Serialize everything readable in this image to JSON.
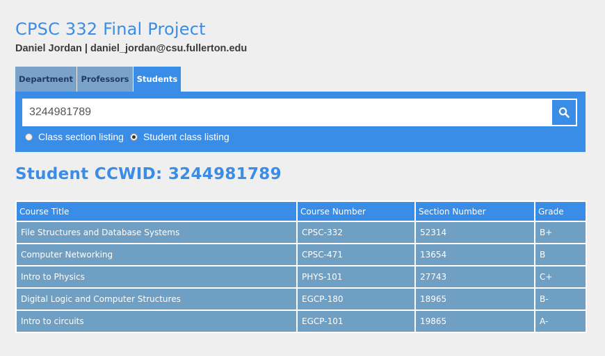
{
  "header": {
    "title": "CPSC 332 Final Project",
    "author": "Daniel Jordan | daniel_jordan@csu.fullerton.edu"
  },
  "tabs": [
    {
      "label": "Department",
      "active": false
    },
    {
      "label": "Professors",
      "active": false
    },
    {
      "label": "Students",
      "active": true
    }
  ],
  "search": {
    "value": "3244981789",
    "button_icon": "search-icon",
    "options": [
      {
        "label": "Class section listing",
        "checked": false
      },
      {
        "label": "Student class listing",
        "checked": true
      }
    ]
  },
  "results": {
    "heading": "Student CCWID: 3244981789",
    "columns": [
      "Course Title",
      "Course Number",
      "Section Number",
      "Grade"
    ],
    "rows": [
      [
        "File Structures and Database Systems",
        "CPSC-332",
        "52314",
        "B+"
      ],
      [
        "Computer Networking",
        "CPSC-471",
        "13654",
        "B"
      ],
      [
        "Intro to Physics",
        "PHYS-101",
        "27743",
        "C+"
      ],
      [
        "Digital Logic and Computer Structures",
        "EGCP-180",
        "18965",
        "B-"
      ],
      [
        "Intro to circuits",
        "EGCP-101",
        "19865",
        "A-"
      ]
    ]
  },
  "colors": {
    "accent": "#3a8de6",
    "row_bg": "#6f9fc3",
    "inactive_tab": "#7ba3c9",
    "page_bg": "#efefef"
  }
}
